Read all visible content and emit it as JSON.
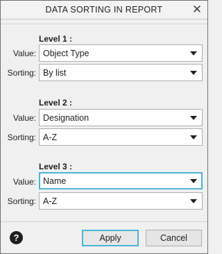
{
  "dialog": {
    "title": "DATA SORTING IN REPORT"
  },
  "labels": {
    "value": "Value:",
    "sorting": "Sorting:"
  },
  "levels": [
    {
      "title": "Level  1 :",
      "value": "Object Type",
      "sorting": "By list"
    },
    {
      "title": "Level  2 :",
      "value": "Designation",
      "sorting": "A-Z"
    },
    {
      "title": "Level  3 :",
      "value": "Name",
      "sorting": "A-Z"
    }
  ],
  "footer": {
    "help_glyph": "?",
    "apply_label": "Apply",
    "cancel_label": "Cancel"
  },
  "icons": {
    "close": "close-icon",
    "help": "help-icon",
    "dropdown": "chevron-down-icon"
  },
  "colors": {
    "focus_accent": "#4bb5d3",
    "background": "#f0f0f0"
  }
}
